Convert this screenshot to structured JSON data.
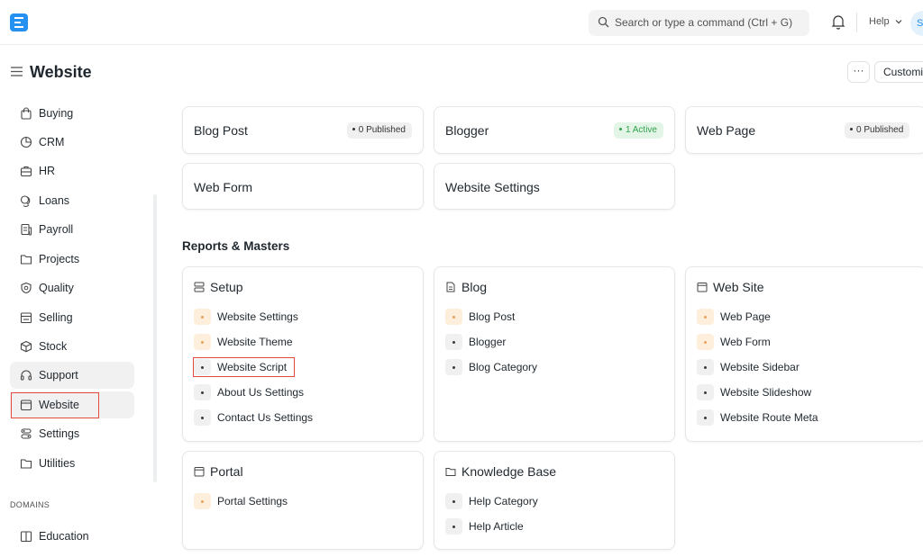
{
  "navbar": {
    "search_placeholder": "Search or type a command (Ctrl + G)",
    "help_label": "Help",
    "avatar_initial": "S"
  },
  "page": {
    "title": "Website",
    "more_label": "···",
    "customize_label": "Customize"
  },
  "sidebar": {
    "items": [
      {
        "label": "Buying",
        "icon": "shopping-bag-icon"
      },
      {
        "label": "CRM",
        "icon": "pie-chart-icon"
      },
      {
        "label": "HR",
        "icon": "briefcase-icon"
      },
      {
        "label": "Loans",
        "icon": "coins-icon"
      },
      {
        "label": "Payroll",
        "icon": "receipt-icon"
      },
      {
        "label": "Projects",
        "icon": "folder-icon"
      },
      {
        "label": "Quality",
        "icon": "shield-icon"
      },
      {
        "label": "Selling",
        "icon": "store-icon"
      },
      {
        "label": "Stock",
        "icon": "box-icon"
      },
      {
        "label": "Support",
        "icon": "headset-icon"
      },
      {
        "label": "Website",
        "icon": "browser-window-icon"
      },
      {
        "label": "Settings",
        "icon": "settings-sliders-icon"
      },
      {
        "label": "Utilities",
        "icon": "folder-icon"
      }
    ],
    "domains_label": "DOMAINS",
    "domain_items": [
      {
        "label": "Education",
        "icon": "book-icon"
      }
    ],
    "active_item": "Website"
  },
  "shortcuts": [
    {
      "label": "Blog Post",
      "badge": "0 Published",
      "badge_color": "gray"
    },
    {
      "label": "Blogger",
      "badge": "1 Active",
      "badge_color": "green"
    },
    {
      "label": "Web Page",
      "badge": "0 Published",
      "badge_color": "gray"
    },
    {
      "label": "Web Form"
    },
    {
      "label": "Website Settings"
    }
  ],
  "reports_title": "Reports & Masters",
  "link_cards": [
    {
      "title": "Setup",
      "icon": "server-icon",
      "links": [
        {
          "label": "Website Settings",
          "dot": "orange"
        },
        {
          "label": "Website Theme",
          "dot": "orange"
        },
        {
          "label": "Website Script",
          "dot": "gray"
        },
        {
          "label": "About Us Settings",
          "dot": "gray"
        },
        {
          "label": "Contact Us Settings",
          "dot": "gray"
        }
      ]
    },
    {
      "title": "Blog",
      "icon": "document-icon",
      "links": [
        {
          "label": "Blog Post",
          "dot": "orange"
        },
        {
          "label": "Blogger",
          "dot": "gray"
        },
        {
          "label": "Blog Category",
          "dot": "gray"
        }
      ]
    },
    {
      "title": "Web Site",
      "icon": "browser-window-icon",
      "links": [
        {
          "label": "Web Page",
          "dot": "orange"
        },
        {
          "label": "Web Form",
          "dot": "orange"
        },
        {
          "label": "Website Sidebar",
          "dot": "gray"
        },
        {
          "label": "Website Slideshow",
          "dot": "gray"
        },
        {
          "label": "Website Route Meta",
          "dot": "gray"
        }
      ]
    },
    {
      "title": "Portal",
      "icon": "browser-window-icon",
      "links": [
        {
          "label": "Portal Settings",
          "dot": "orange"
        }
      ]
    },
    {
      "title": "Knowledge Base",
      "icon": "folder-icon",
      "links": [
        {
          "label": "Help Category",
          "dot": "gray"
        },
        {
          "label": "Help Article",
          "dot": "gray"
        }
      ]
    }
  ],
  "colors": {
    "accent": "#2490ef",
    "highlight_box": "#e24c3f",
    "orange_dot_bg": "#fdefdc",
    "green_badge_text": "#30a14e"
  }
}
